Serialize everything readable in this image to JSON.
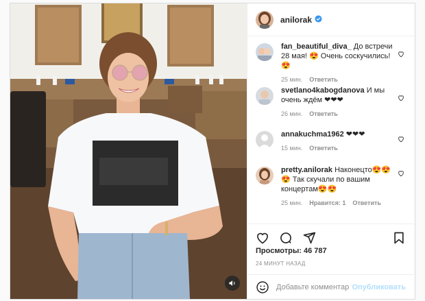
{
  "post": {
    "author": "anilorak",
    "verified_icon": "verified-badge-icon",
    "views_label": "Просмотры:",
    "views_count": "46 787",
    "time_ago": "24 МИНУТ НАЗАД"
  },
  "comments": [
    {
      "username": "fan_beautiful_diva_",
      "text": "До встречи 28 мая! 😍 Очень соскучились! 😍",
      "time": "25 мин.",
      "reply": "Ответить",
      "likes": ""
    },
    {
      "username": "svetlano4kabogdanova",
      "text": "И мы очень ждём ❤❤❤",
      "time": "26 мин.",
      "reply": "Ответить",
      "likes": ""
    },
    {
      "username": "annakuchma1962",
      "text": "❤❤❤",
      "time": "15 мин.",
      "reply": "Ответить",
      "likes": ""
    },
    {
      "username": "pretty.anilorak",
      "text": "Наконецто😍😍😍 Так скучали по вашим концертам😍😍",
      "time": "25 мин.",
      "reply": "Ответить",
      "likes": "Нравится: 1"
    }
  ],
  "composer": {
    "placeholder": "Добавьте комментарий...",
    "publish_label": "Опубликовать"
  },
  "colors": {
    "link": "#0095f6",
    "publish_disabled": "#b2dffc",
    "muted": "#8e8e8e",
    "text": "#262626"
  }
}
